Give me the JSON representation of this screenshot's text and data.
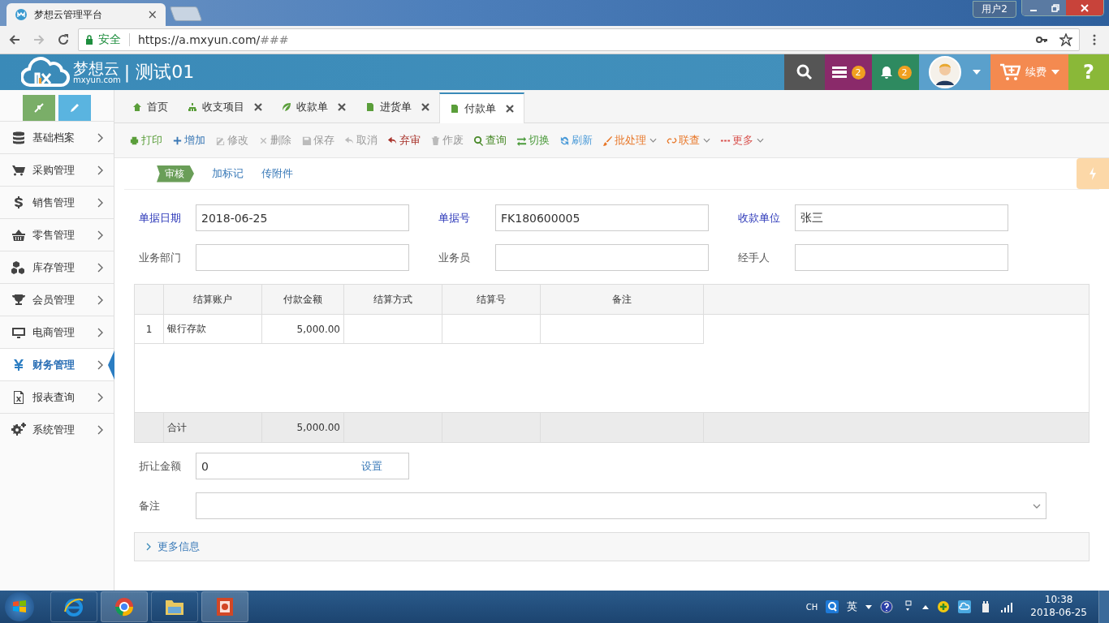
{
  "browser": {
    "tab_title": "梦想云管理平台",
    "tab_close": "×",
    "user_label": "用户2",
    "security": "安全",
    "url": "https://a.mxyun.com/",
    "url_hash": "###"
  },
  "header": {
    "logo_name": "梦想云",
    "logo_domain": "mxyun.com",
    "company": "| 测试01",
    "task_count": "2",
    "notice_count": "2",
    "renew": "续费",
    "help": "?"
  },
  "sidebar": {
    "items": [
      {
        "label": "基础档案",
        "selected": false
      },
      {
        "label": "采购管理",
        "selected": false
      },
      {
        "label": "销售管理",
        "selected": false
      },
      {
        "label": "零售管理",
        "selected": false
      },
      {
        "label": "库存管理",
        "selected": false
      },
      {
        "label": "会员管理",
        "selected": false
      },
      {
        "label": "电商管理",
        "selected": false
      },
      {
        "label": "财务管理",
        "selected": true
      },
      {
        "label": "报表查询",
        "selected": false
      },
      {
        "label": "系统管理",
        "selected": false
      }
    ]
  },
  "tabs": [
    {
      "label": "首页",
      "selected": false,
      "closable": false
    },
    {
      "label": "收支项目",
      "selected": false,
      "closable": true
    },
    {
      "label": "收款单",
      "selected": false,
      "closable": true
    },
    {
      "label": "进货单",
      "selected": false,
      "closable": true
    },
    {
      "label": "付款单",
      "selected": true,
      "closable": true
    }
  ],
  "toolbar": [
    {
      "label": "打印",
      "disabled": false,
      "dropdown": false,
      "color": "#5a9e3a"
    },
    {
      "label": "增加",
      "disabled": false,
      "dropdown": false,
      "color": "#3a78b5"
    },
    {
      "label": "修改",
      "disabled": true,
      "dropdown": false
    },
    {
      "label": "删除",
      "disabled": true,
      "dropdown": false
    },
    {
      "label": "保存",
      "disabled": true,
      "dropdown": false
    },
    {
      "label": "取消",
      "disabled": true,
      "dropdown": false
    },
    {
      "label": "弃审",
      "disabled": false,
      "dropdown": false,
      "color": "#a8322a"
    },
    {
      "label": "作废",
      "disabled": true,
      "dropdown": false
    },
    {
      "label": "查询",
      "disabled": false,
      "dropdown": false,
      "color": "#4a8a2a"
    },
    {
      "label": "切换",
      "disabled": false,
      "dropdown": false,
      "color": "#4a9a3a"
    },
    {
      "label": "刷新",
      "disabled": false,
      "dropdown": false,
      "color": "#4a9ad8"
    },
    {
      "label": "批处理",
      "disabled": false,
      "dropdown": true,
      "color": "#e8782a"
    },
    {
      "label": "联查",
      "disabled": false,
      "dropdown": true,
      "color": "#e8782a"
    },
    {
      "label": "更多",
      "disabled": false,
      "dropdown": true,
      "color": "#d9534f"
    }
  ],
  "sub_actions": {
    "status": "审核",
    "links": [
      "加标记",
      "传附件"
    ]
  },
  "form": {
    "fields": [
      {
        "label": "单据日期",
        "value": "2018-06-25",
        "required": true
      },
      {
        "label": "单据号",
        "value": "FK180600005",
        "required": true
      },
      {
        "label": "收款单位",
        "value": "张三",
        "required": true
      },
      {
        "label": "业务部门",
        "required": false
      },
      {
        "label": "业务员",
        "required": false
      },
      {
        "label": "经手人",
        "required": false
      }
    ]
  },
  "table": {
    "columns": [
      "结算账户",
      "付款金额",
      "结算方式",
      "结算号",
      "备注"
    ],
    "rows": [
      {
        "number": "1",
        "account": "银行存款",
        "amount": "5,000.00"
      }
    ],
    "total": {
      "label": "合计",
      "amount": "5,000.00"
    }
  },
  "discount": {
    "label": "折让金额",
    "value": "0",
    "action": "设置"
  },
  "remark": {
    "label": "备注"
  },
  "more_info": {
    "label": "更多信息",
    "expanded": false
  },
  "taskbar": {
    "lang": "CH",
    "ime": "英",
    "time": "10:38",
    "date": "2018-06-25"
  }
}
